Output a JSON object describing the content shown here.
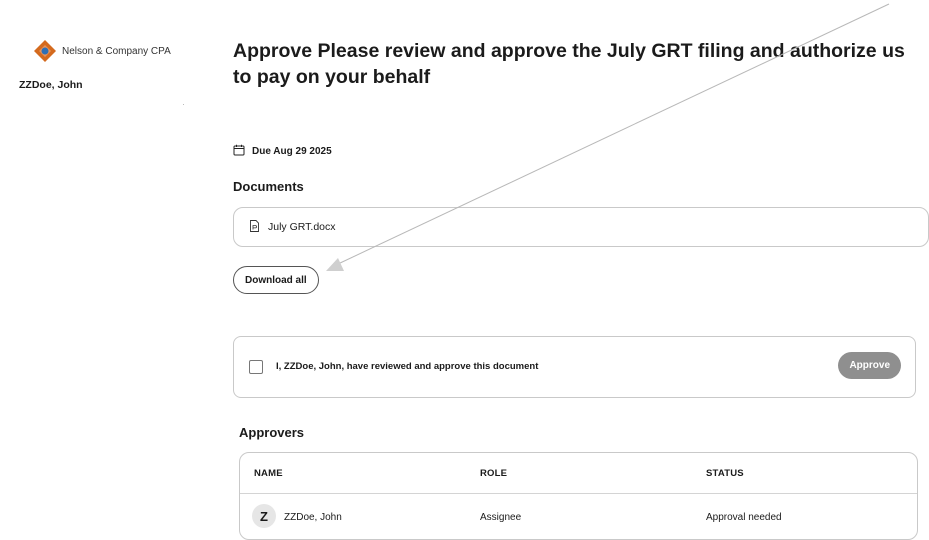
{
  "sidebar": {
    "brand_name": "Nelson & Company CPA",
    "user_name": "ZZDoe, John",
    "logo_colors": {
      "diamond": "#d46a1e",
      "center": "#2e6fb5"
    }
  },
  "main": {
    "title": "Approve Please review and approve the July GRT filing and authorize us to pay on your behalf",
    "due_icon": "calendar-icon",
    "due_label": "Due Aug 29 2025",
    "documents_heading": "Documents",
    "documents": [
      {
        "icon": "document-icon",
        "name": "July GRT.docx"
      }
    ],
    "download_all_label": "Download all",
    "approval": {
      "checked": false,
      "statement": "I, ZZDoe, John, have reviewed and approve this document",
      "approve_label": "Approve"
    },
    "approvers_heading": "Approvers",
    "approvers_table": {
      "columns": [
        "NAME",
        "ROLE",
        "STATUS"
      ],
      "rows": [
        {
          "initial": "Z",
          "name": "ZZDoe, John",
          "role": "Assignee",
          "status": "Approval needed"
        }
      ]
    }
  }
}
